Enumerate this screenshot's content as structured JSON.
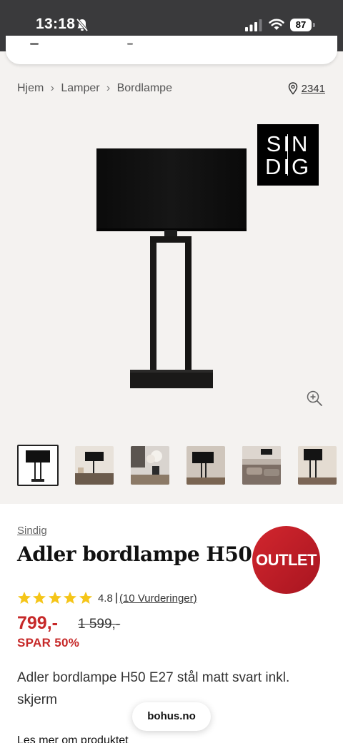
{
  "status_bar": {
    "time": "13:18",
    "battery": "87"
  },
  "breadcrumb": {
    "items": [
      "Hjem",
      "Lamper",
      "Bordlampe"
    ],
    "store_number": "2341"
  },
  "brand_logo": {
    "line1": "SIN",
    "line2": "DIG"
  },
  "product": {
    "brand": "Sindig",
    "title": "Adler bordlampe H50",
    "badge": "OUTLET",
    "rating": "4.8",
    "rating_sep": "|",
    "reviews": "(10 Vurderinger)",
    "stars": 5,
    "price": "799,-",
    "old_price": "1 599,-",
    "save": "SPAR 50%",
    "description": "Adler bordlampe H50 E27 stål matt svart inkl. skjerm",
    "read_more": "Les mer om produktet"
  },
  "browser": {
    "domain": "bohus.no"
  },
  "colors": {
    "accent_red": "#c62828",
    "badge_red": "#d2262e",
    "star_yellow": "#f5c518",
    "status_bar": "#3a3a3c"
  }
}
